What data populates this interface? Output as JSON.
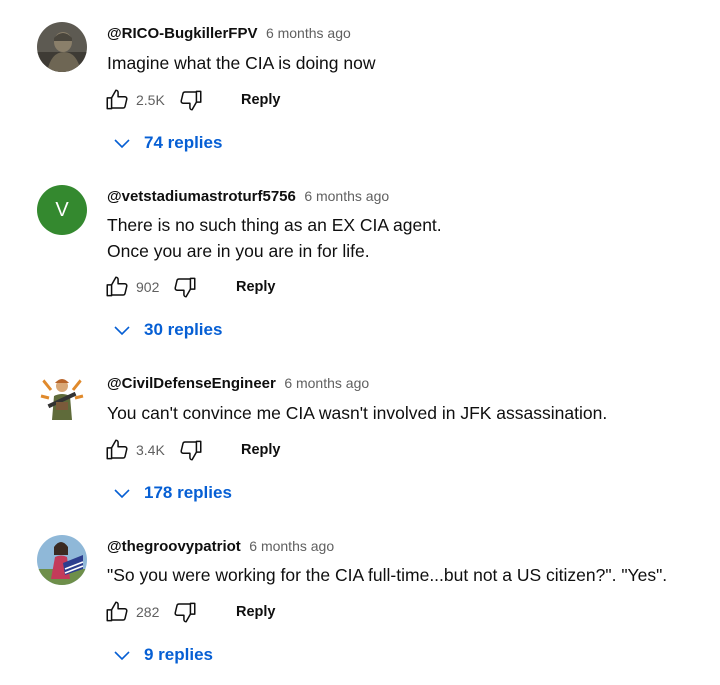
{
  "comments": [
    {
      "author": "@RICO-BugkillerFPV",
      "time": "6 months ago",
      "lines": [
        "Imagine what the CIA is doing now"
      ],
      "likes": "2.5K",
      "reply_label": "Reply",
      "replies_label": "74 replies",
      "avatar_icon": "soldier-photo"
    },
    {
      "author": "@vetstadiumastroturf5756",
      "time": "6 months ago",
      "lines": [
        "There is no such thing as an EX CIA agent.",
        "Once you are in you are in for life."
      ],
      "likes": "902",
      "reply_label": "Reply",
      "replies_label": "30 replies",
      "avatar_letter": "V",
      "avatar_color": "#34892f"
    },
    {
      "author": "@CivilDefenseEngineer",
      "time": "6 months ago",
      "lines": [
        "You can't convince me CIA wasn't involved in JFK assassination."
      ],
      "likes": "3.4K",
      "reply_label": "Reply",
      "replies_label": "178 replies",
      "avatar_icon": "cartoon-soldier"
    },
    {
      "author": "@thegroovypatriot",
      "time": "6 months ago",
      "lines": [
        "\"So you were working for the CIA full-time...but not a US citizen?\". \"Yes\"."
      ],
      "likes": "282",
      "reply_label": "Reply",
      "replies_label": "9 replies",
      "avatar_icon": "woman-flag-photo"
    }
  ],
  "colors": {
    "link_blue": "#065fd4",
    "meta_gray": "#606060",
    "text": "#0f0f0f"
  }
}
